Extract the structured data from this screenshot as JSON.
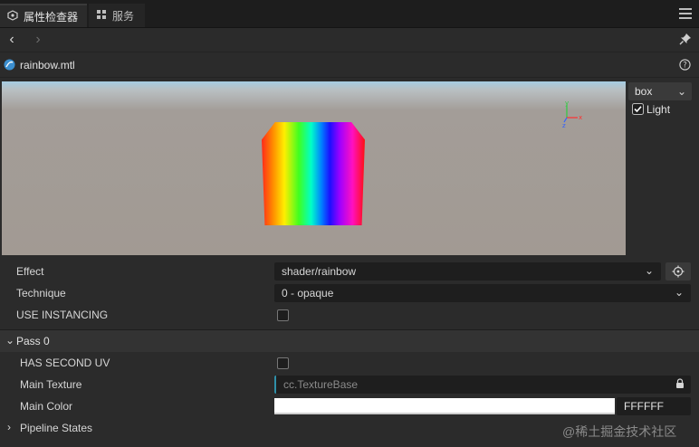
{
  "tabs": [
    {
      "label": "属性检查器",
      "icon": "cube-settings-icon"
    },
    {
      "label": "服务",
      "icon": "grid-icon"
    }
  ],
  "file": {
    "name": "rainbow.mtl"
  },
  "preview": {
    "mesh_select": "box",
    "light_label": "Light",
    "light_checked": true,
    "gizmo": {
      "y": "y",
      "x": "x",
      "z": "z"
    }
  },
  "properties": {
    "effect": {
      "label": "Effect",
      "value": "shader/rainbow"
    },
    "technique": {
      "label": "Technique",
      "value": "0 - opaque"
    },
    "use_instancing": {
      "label": "USE INSTANCING",
      "checked": false
    }
  },
  "pass": {
    "title": "Pass 0",
    "has_second_uv": {
      "label": "HAS SECOND UV",
      "checked": false
    },
    "main_texture": {
      "label": "Main Texture",
      "placeholder": "cc.TextureBase"
    },
    "main_color": {
      "label": "Main Color",
      "hex": "FFFFFF",
      "color": "#ffffff"
    },
    "pipeline_states": {
      "label": "Pipeline States"
    }
  },
  "watermark": "@稀土掘金技术社区",
  "colors": {
    "accent_texture_border": "#2f8fa8"
  }
}
